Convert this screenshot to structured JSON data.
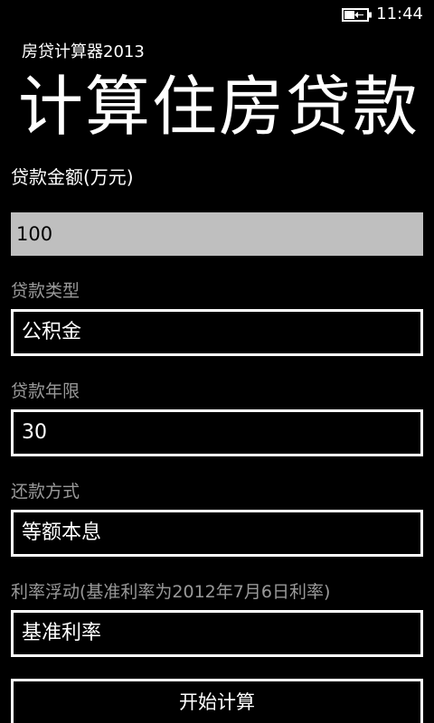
{
  "status_bar": {
    "time": "11:44",
    "battery_icon": "battery-charging-icon"
  },
  "app": {
    "title": "房贷计算器2013",
    "page_title": "计算住房贷款"
  },
  "form": {
    "amount": {
      "label": "贷款金额(万元)",
      "value": "100"
    },
    "loan_type": {
      "label": "贷款类型",
      "selected": "公积金"
    },
    "loan_term": {
      "label": "贷款年限",
      "selected": "30"
    },
    "repayment": {
      "label": "还款方式",
      "selected": "等额本息"
    },
    "rate": {
      "label": "利率浮动(基准利率为2012年7月6日利率)",
      "selected": "基准利率"
    },
    "submit_label": "开始计算"
  },
  "colors": {
    "background": "#000000",
    "foreground": "#ffffff",
    "label_dim": "#999999",
    "input_fill": "#bfbfbf"
  }
}
